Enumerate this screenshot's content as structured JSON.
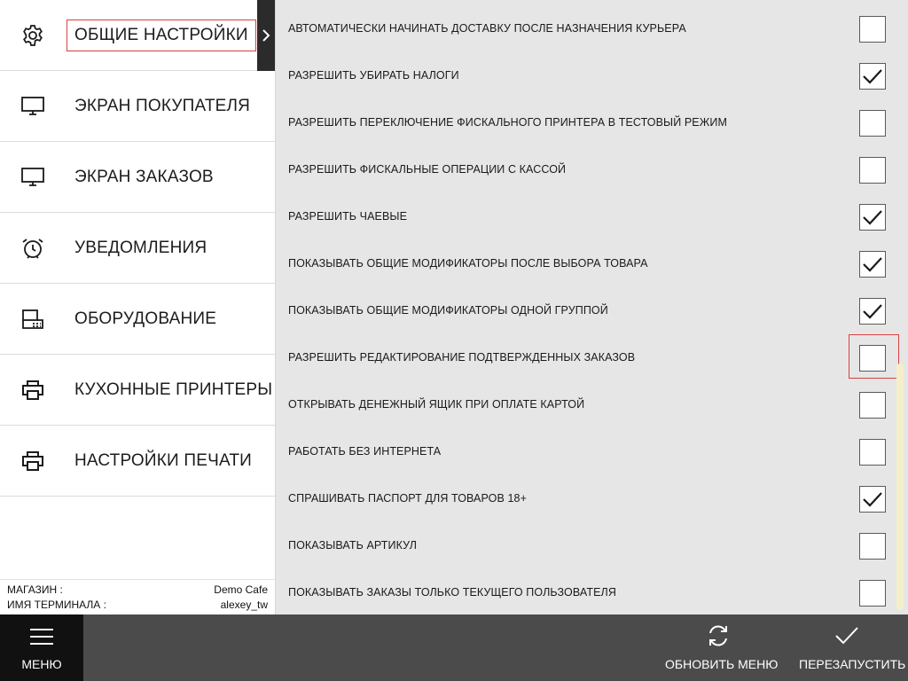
{
  "sidebar": {
    "items": [
      {
        "label": "ОБЩИЕ НАСТРОЙКИ",
        "icon": "gear-icon",
        "active": true
      },
      {
        "label": "ЭКРАН ПОКУПАТЕЛЯ",
        "icon": "monitor-icon",
        "active": false
      },
      {
        "label": "ЭКРАН ЗАКАЗОВ",
        "icon": "monitor-icon",
        "active": false
      },
      {
        "label": "УВЕДОМЛЕНИЯ",
        "icon": "alarm-clock-icon",
        "active": false
      },
      {
        "label": "ОБОРУДОВАНИЕ",
        "icon": "cash-register-icon",
        "active": false
      },
      {
        "label": "КУХОННЫЕ ПРИНТЕРЫ",
        "icon": "printer-icon",
        "active": false
      },
      {
        "label": "НАСТРОЙКИ ПЕЧАТИ",
        "icon": "printer-icon",
        "active": false
      }
    ],
    "store": {
      "shop_label": "МАГАЗИН :",
      "shop_value": "Demo Cafe",
      "terminal_label": "ИМЯ ТЕРМИНАЛА :",
      "terminal_value": "alexey_tw"
    }
  },
  "settings": [
    {
      "label": "АВТОМАТИЧЕСКИ НАЧИНАТЬ ДОСТАВКУ ПОСЛЕ НАЗНАЧЕНИЯ КУРЬЕРА",
      "checked": false
    },
    {
      "label": "РАЗРЕШИТЬ УБИРАТЬ НАЛОГИ",
      "checked": true
    },
    {
      "label": "РАЗРЕШИТЬ ПЕРЕКЛЮЧЕНИЕ ФИСКАЛЬНОГО ПРИНТЕРА В ТЕСТОВЫЙ РЕЖИМ",
      "checked": false
    },
    {
      "label": "РАЗРЕШИТЬ ФИСКАЛЬНЫЕ ОПЕРАЦИИ С КАССОЙ",
      "checked": false
    },
    {
      "label": "РАЗРЕШИТЬ ЧАЕВЫЕ",
      "checked": true
    },
    {
      "label": "ПОКАЗЫВАТЬ ОБЩИЕ МОДИФИКАТОРЫ ПОСЛЕ ВЫБОРА ТОВАРА",
      "checked": true
    },
    {
      "label": "ПОКАЗЫВАТЬ ОБЩИЕ МОДИФИКАТОРЫ ОДНОЙ ГРУППОЙ",
      "checked": true
    },
    {
      "label": "РАЗРЕШИТЬ РЕДАКТИРОВАНИЕ ПОДТВЕРЖДЕННЫХ ЗАКАЗОВ",
      "checked": false,
      "highlighted": true
    },
    {
      "label": "ОТКРЫВАТЬ ДЕНЕЖНЫЙ ЯЩИК ПРИ ОПЛАТЕ КАРТОЙ",
      "checked": false
    },
    {
      "label": "РАБОТАТЬ БЕЗ ИНТЕРНЕТА",
      "checked": false
    },
    {
      "label": "СПРАШИВАТЬ ПАСПОРТ ДЛЯ ТОВАРОВ 18+",
      "checked": true
    },
    {
      "label": "ПОКАЗЫВАТЬ АРТИКУЛ",
      "checked": false
    },
    {
      "label": "ПОКАЗЫВАТЬ ЗАКАЗЫ ТОЛЬКО ТЕКУЩЕГО ПОЛЬЗОВАТЕЛЯ",
      "checked": false
    }
  ],
  "bottom_bar": {
    "menu_label": "МЕНЮ",
    "refresh_label": "ОБНОВИТЬ МЕНЮ",
    "restart_label": "ПЕРЕЗАПУСТИТЬ"
  },
  "colors": {
    "highlight": "#d94040",
    "bottom_bar": "#4b4b4b",
    "menu_button": "#111111",
    "content_bg": "#e6e6e6"
  }
}
